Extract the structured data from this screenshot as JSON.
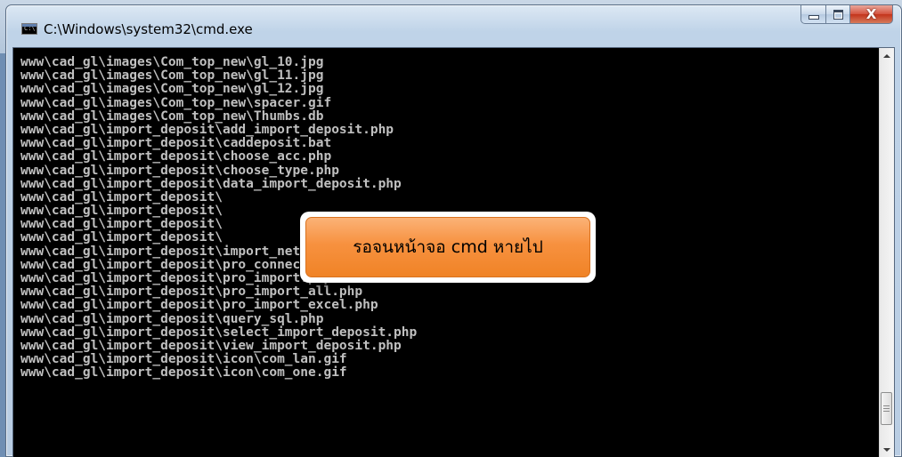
{
  "window": {
    "title": "C:\\Windows\\system32\\cmd.exe",
    "icon": "cmd-console-icon",
    "icon_glyph": "C:\\",
    "controls": {
      "minimize_icon": "minimize-icon",
      "maximize_icon": "maximize-icon",
      "close_glyph": "X"
    }
  },
  "console": {
    "background_color": "#000000",
    "text_color": "#c0c0c0",
    "lines": [
      "www\\cad_gl\\images\\Com_top_new\\gl_10.jpg",
      "www\\cad_gl\\images\\Com_top_new\\gl_11.jpg",
      "www\\cad_gl\\images\\Com_top_new\\gl_12.jpg",
      "www\\cad_gl\\images\\Com_top_new\\spacer.gif",
      "www\\cad_gl\\images\\Com_top_new\\Thumbs.db",
      "www\\cad_gl\\import_deposit\\add_import_deposit.php",
      "www\\cad_gl\\import_deposit\\caddeposit.bat",
      "www\\cad_gl\\import_deposit\\choose_acc.php",
      "www\\cad_gl\\import_deposit\\choose_type.php",
      "www\\cad_gl\\import_deposit\\data_import_deposit.php",
      "www\\cad_gl\\import_deposit\\",
      "www\\cad_gl\\import_deposit\\",
      "www\\cad_gl\\import_deposit\\",
      "www\\cad_gl\\import_deposit\\",
      "www\\cad_gl\\import_deposit\\import_network.php",
      "www\\cad_gl\\import_deposit\\pro_connect.php",
      "www\\cad_gl\\import_deposit\\pro_import.php",
      "www\\cad_gl\\import_deposit\\pro_import_all.php",
      "www\\cad_gl\\import_deposit\\pro_import_excel.php",
      "www\\cad_gl\\import_deposit\\query_sql.php",
      "www\\cad_gl\\import_deposit\\select_import_deposit.php",
      "www\\cad_gl\\import_deposit\\view_import_deposit.php",
      "www\\cad_gl\\import_deposit\\icon\\com_lan.gif",
      "www\\cad_gl\\import_deposit\\icon\\com_one.gif"
    ]
  },
  "scrollbar": {
    "position_fraction": 0.95
  },
  "callout": {
    "text": "รอจนหน้าจอ cmd หายไป",
    "accent_color": "#f7913f"
  }
}
